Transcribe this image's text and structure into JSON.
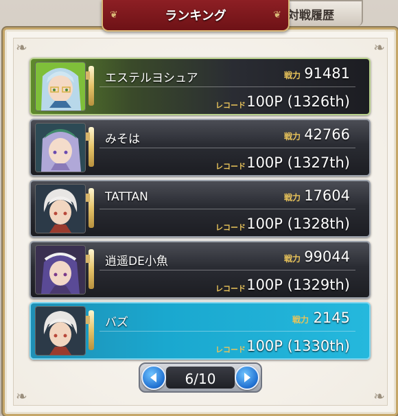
{
  "tabs": {
    "active_label": "ランキング",
    "inactive_label": "対戦履歴"
  },
  "labels": {
    "power": "戦力",
    "record": "レコード"
  },
  "rows": [
    {
      "name": "エステルヨシュア",
      "power": "91481",
      "record": "100P (1326th)",
      "state": "self",
      "avatar": "silver-hair-glasses"
    },
    {
      "name": "みそは",
      "power": "42766",
      "record": "100P (1327th)",
      "state": "normal",
      "avatar": "lavender-hair-green-hat"
    },
    {
      "name": "TATTAN",
      "power": "17604",
      "record": "100P (1328th)",
      "state": "normal",
      "avatar": "white-hair-boy"
    },
    {
      "name": "逍遥DE小魚",
      "power": "99044",
      "record": "100P (1329th)",
      "state": "normal",
      "avatar": "purple-hair-headband"
    },
    {
      "name": "バズ",
      "power": "2145",
      "record": "100P (1330th)",
      "state": "selected",
      "avatar": "white-hair-boy"
    }
  ],
  "pager": {
    "text": "6/10",
    "prev_icon": "left-arrow-icon",
    "next_icon": "right-arrow-icon"
  },
  "colors": {
    "self_row": "#5f8a2c",
    "selected_row": "#1aa8cf",
    "gold_label": "#e8c35a",
    "tab_red": "#8d1f24"
  }
}
